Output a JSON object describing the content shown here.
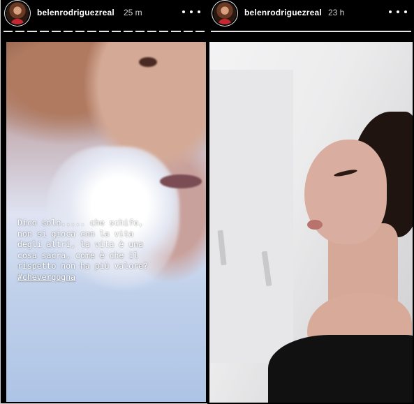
{
  "stories": [
    {
      "username": "belenrodriguezreal",
      "time": "25 m",
      "caption_lines": [
        "Dico solo..... che schifo,",
        "non si gioca con la vita",
        "degli altri, la vita è una",
        "cosa sacra, come è che il",
        "rispetto non ha più valore?"
      ],
      "hashtag": "#chevergogna"
    },
    {
      "username": "belenrodriguezreal",
      "time": "23 h"
    }
  ],
  "icons": {
    "avatar": "profile-avatar",
    "more": "more-options-icon"
  }
}
